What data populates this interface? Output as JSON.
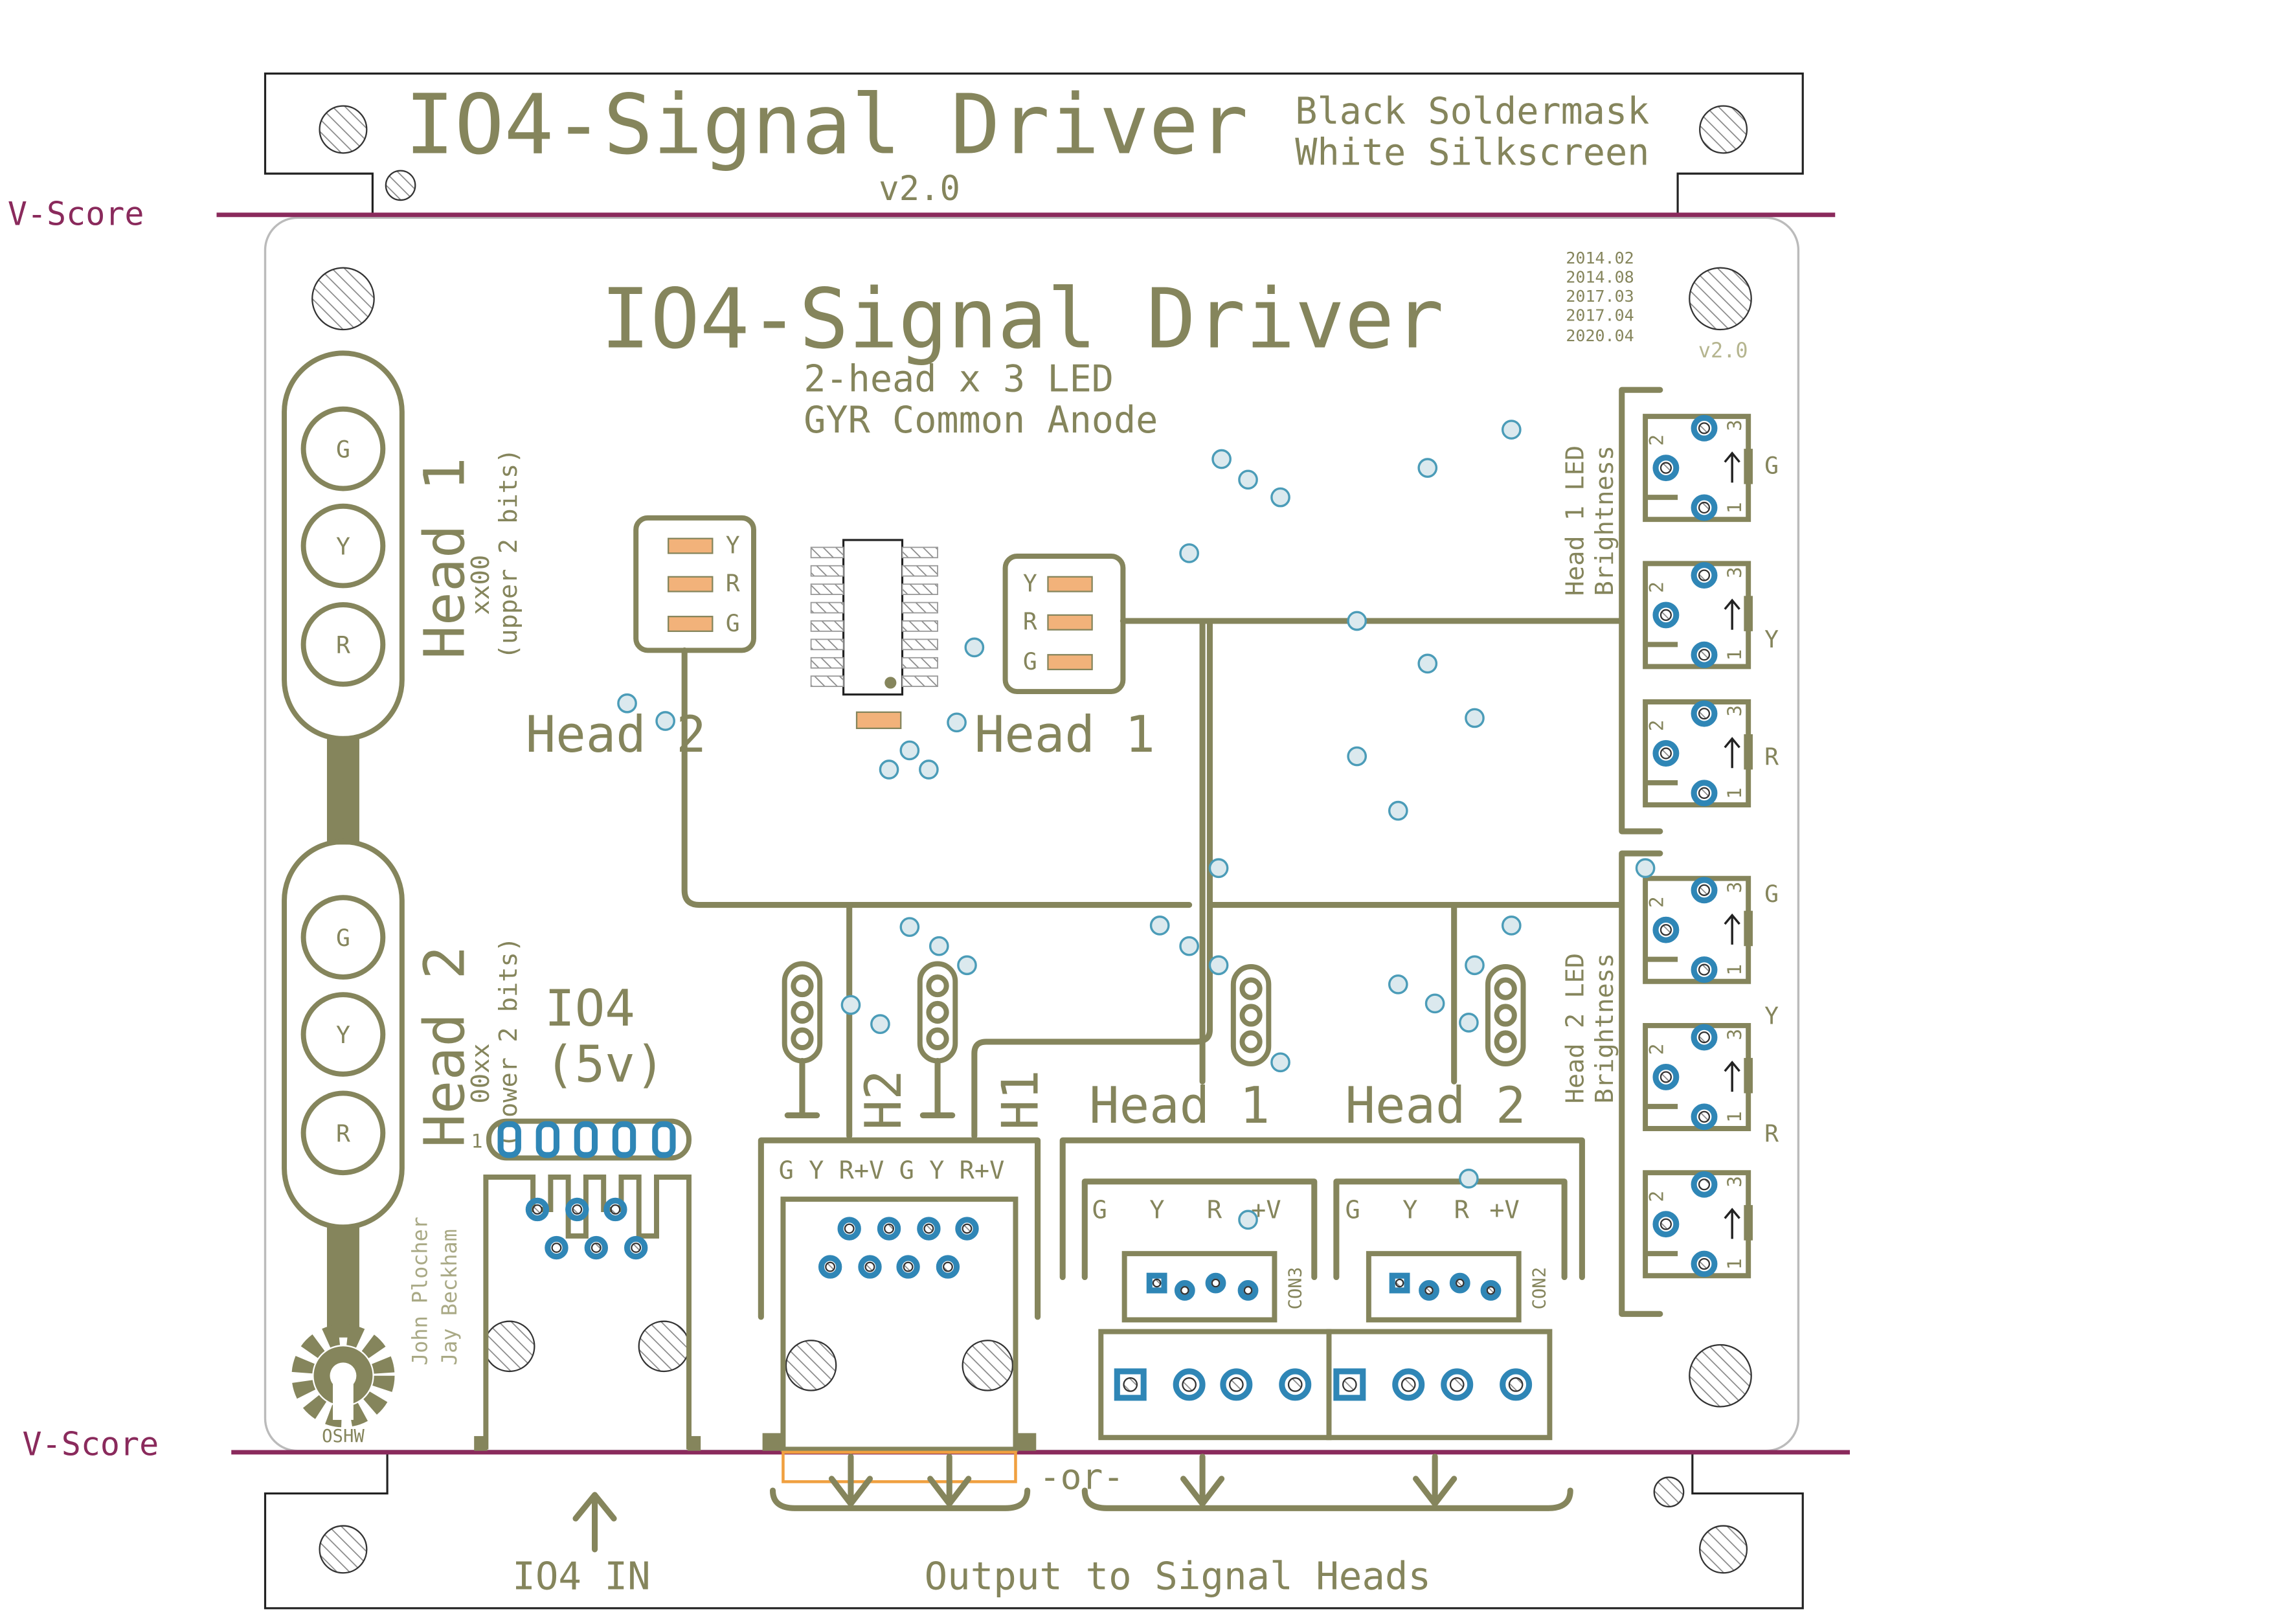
{
  "colors": {
    "silkscreen": "#85855c",
    "vscore": "#8a2a5c",
    "pad": "#2f86b6",
    "led": "#f0a040",
    "outline": "#222222"
  },
  "header_panel": {
    "title": "IO4-Signal Driver",
    "note_line1": "Black Soldermask",
    "note_line2": "White Silkscreen",
    "version": "v2.0"
  },
  "vscore": {
    "top": "V-Score",
    "bottom": "V-Score"
  },
  "board": {
    "title": "IO4-Signal Driver",
    "subtitle1": "2-head x 3 LED",
    "subtitle2": "GYR Common Anode",
    "dates": [
      "2014.02",
      "2014.08",
      "2017.03",
      "2017.04",
      "2020.04"
    ],
    "version": "v2.0",
    "head1_signal": {
      "lamps": [
        "G",
        "Y",
        "R"
      ],
      "label": "Head 1",
      "bits": "xx00",
      "bits_note": "(upper 2 bits)"
    },
    "head2_signal": {
      "lamps": [
        "G",
        "Y",
        "R"
      ],
      "label": "Head 2",
      "bits": "00xx",
      "bits_note": "(lower 2 bits)"
    },
    "io4_label1": "IO4",
    "io4_label2": "(5v)",
    "pin1": "1",
    "authors": [
      "John Plocher",
      "Jay Beckham"
    ],
    "oshw": "OSHW",
    "head2_leds": [
      "Y",
      "R",
      "G"
    ],
    "head1_leds": [
      "Y",
      "R",
      "G"
    ],
    "head2_label": "Head 2",
    "head1_label": "Head 1",
    "brightness1": {
      "line1": "Head 1 LED",
      "line2": "Brightness",
      "colors": [
        "G",
        "Y",
        "R"
      ]
    },
    "brightness2": {
      "line1": "Head 2 LED",
      "line2": "Brightness",
      "colors": [
        "G",
        "Y",
        "R"
      ]
    },
    "pot_pins": [
      "2",
      "3",
      "1"
    ],
    "rj45_out_pins": "G Y R+V G Y R+V",
    "h2": "H2",
    "h1": "H1",
    "head1_term": "Head 1",
    "head2_term": "Head 2",
    "con3": {
      "pins": [
        "G",
        "Y",
        "R",
        "+V"
      ],
      "name": "CON3"
    },
    "con2": {
      "pins": [
        "G",
        "Y",
        "R",
        "+V"
      ],
      "name": "CON2"
    }
  },
  "footer_panel": {
    "or": "-or-",
    "io4_in": "IO4 IN",
    "output": "Output to Signal Heads"
  }
}
